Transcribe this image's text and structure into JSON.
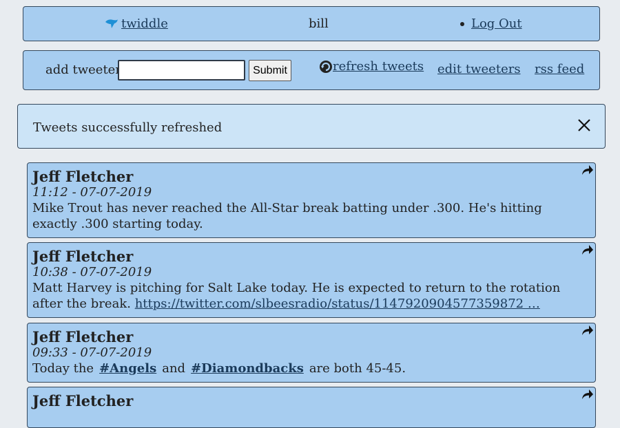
{
  "nav": {
    "brand": "twiddle",
    "user": "bill",
    "logout": "Log Out"
  },
  "toolbar": {
    "add_label": "add tweeter:",
    "input_value": "",
    "submit_label": "Submit",
    "refresh_label": "refresh tweets",
    "edit_label": "edit tweeters",
    "rss_label": "rss feed"
  },
  "alert": {
    "message": "Tweets successfully refreshed"
  },
  "tweets": [
    {
      "author": "Jeff Fletcher",
      "time": "11:12 - 07-07-2019",
      "text": "Mike Trout has never reached the All-Star break batting under .300. He's hitting exactly .300 starting today."
    },
    {
      "author": "Jeff Fletcher",
      "time": "10:38 - 07-07-2019",
      "text": "Matt Harvey is pitching for Salt Lake today. He is expected to return to the rotation after the break.",
      "link": "https://twitter.com/slbeesradio/status/1147920904577359872 …"
    },
    {
      "author": "Jeff Fletcher",
      "time": "09:33 - 07-07-2019",
      "text_prefix": "Today the",
      "tag1": "#Angels",
      "text_mid": "and",
      "tag2": "#Diamondbacks",
      "text_suffix": "are both 45-45."
    },
    {
      "author": "Jeff Fletcher"
    }
  ],
  "colors": {
    "panel": "#a7cdf0",
    "alert": "#cce4f7",
    "background": "#e8ecf0",
    "brand_icon": "#1e90d6"
  },
  "icons": {
    "brand": "bird-icon",
    "refresh": "refresh-icon",
    "close": "close-icon",
    "share": "share-arrow-icon"
  }
}
